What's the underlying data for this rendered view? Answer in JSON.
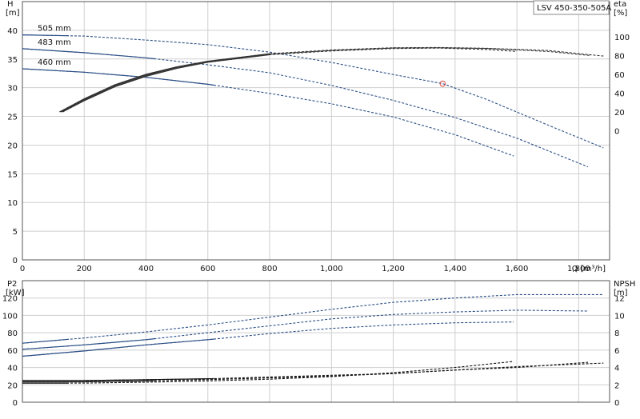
{
  "chart_data": [
    {
      "type": "line",
      "title": "LSV 450-350-505A",
      "x": {
        "label": "Q [m³/h]",
        "lim": [
          0,
          1900
        ],
        "ticks": [
          0,
          200,
          400,
          600,
          800,
          1000,
          1200,
          1400,
          1600,
          1800
        ],
        "tick_labels": [
          "0",
          "200",
          "400",
          "600",
          "800",
          "1,000",
          "1,200",
          "1,400",
          "1,600",
          "1,800"
        ]
      },
      "y_left": {
        "label_line1": "H",
        "label_line2": "[m]",
        "lim": [
          0,
          45
        ],
        "ticks": [
          0,
          5,
          10,
          15,
          20,
          25,
          30,
          35,
          40
        ]
      },
      "y_right": {
        "label_line1": "eta",
        "label_line2": "[%]",
        "lim": [
          -137.5,
          137.5
        ],
        "ticks": [
          0,
          20,
          40,
          60,
          80,
          100
        ]
      },
      "grid": true,
      "operating_point": {
        "x": 1360,
        "y": 30.7,
        "color": "#e0413a"
      },
      "series": [
        {
          "name": "505 mm",
          "axis": "left",
          "color": "#2b4f86",
          "solid_to": 150,
          "points": [
            [
              0,
              39.2
            ],
            [
              200,
              39.0
            ],
            [
              400,
              38.3
            ],
            [
              600,
              37.5
            ],
            [
              800,
              36.2
            ],
            [
              1000,
              34.4
            ],
            [
              1200,
              32.3
            ],
            [
              1360,
              30.7
            ],
            [
              1500,
              28.0
            ],
            [
              1700,
              23.5
            ],
            [
              1880,
              19.5
            ]
          ]
        },
        {
          "name": "483 mm",
          "axis": "left",
          "color": "#2b4f86",
          "solid_to": 430,
          "points": [
            [
              0,
              36.8
            ],
            [
              200,
              36.1
            ],
            [
              400,
              35.2
            ],
            [
              600,
              34.0
            ],
            [
              800,
              32.6
            ],
            [
              1000,
              30.4
            ],
            [
              1200,
              27.8
            ],
            [
              1400,
              24.8
            ],
            [
              1600,
              21.2
            ],
            [
              1830,
              16.2
            ]
          ]
        },
        {
          "name": "460 mm",
          "axis": "left",
          "color": "#2b4f86",
          "solid_to": 620,
          "points": [
            [
              0,
              33.3
            ],
            [
              200,
              32.7
            ],
            [
              400,
              31.8
            ],
            [
              600,
              30.6
            ],
            [
              800,
              29.0
            ],
            [
              1000,
              27.2
            ],
            [
              1200,
              24.9
            ],
            [
              1400,
              21.8
            ],
            [
              1590,
              18.1
            ]
          ]
        },
        {
          "axis": "right",
          "color": "#333333",
          "solid_to": 800,
          "points": [
            [
              120,
              20
            ],
            [
              200,
              34
            ],
            [
              300,
              49
            ],
            [
              400,
              60
            ],
            [
              500,
              68
            ],
            [
              600,
              74
            ],
            [
              800,
              82
            ],
            [
              1000,
              86
            ],
            [
              1200,
              88.4
            ],
            [
              1350,
              88.6
            ],
            [
              1500,
              87.8
            ],
            [
              1700,
              85.5
            ],
            [
              1880,
              79.5
            ]
          ]
        },
        {
          "axis": "right",
          "color": "#333333",
          "solid_to": 800,
          "points": [
            [
              125,
              20
            ],
            [
              200,
              33
            ],
            [
              300,
              48
            ],
            [
              400,
              59
            ],
            [
              500,
              67.5
            ],
            [
              600,
              73.5
            ],
            [
              800,
              81.5
            ],
            [
              1000,
              85.5
            ],
            [
              1200,
              88
            ],
            [
              1350,
              88.3
            ],
            [
              1500,
              87.6
            ],
            [
              1700,
              84.5
            ],
            [
              1840,
              80
            ]
          ]
        },
        {
          "axis": "right",
          "color": "#333333",
          "solid_to": 800,
          "points": [
            [
              130,
              20
            ],
            [
              200,
              32
            ],
            [
              300,
              47
            ],
            [
              400,
              58
            ],
            [
              500,
              66.5
            ],
            [
              600,
              73
            ],
            [
              800,
              81
            ],
            [
              1000,
              85
            ],
            [
              1200,
              87.5
            ],
            [
              1350,
              88
            ],
            [
              1500,
              86.5
            ],
            [
              1600,
              84.5
            ]
          ]
        }
      ]
    },
    {
      "type": "line",
      "x": {
        "lim": [
          0,
          1900
        ],
        "ticks": [
          0,
          200,
          400,
          600,
          800,
          1000,
          1200,
          1400,
          1600,
          1800
        ]
      },
      "y_left": {
        "label_line1": "P2",
        "label_line2": "[kW]",
        "lim": [
          0,
          140
        ],
        "ticks": [
          0,
          20,
          40,
          60,
          80,
          100,
          120
        ]
      },
      "y_right": {
        "label_line1": "NPSH",
        "label_line2": "[m]",
        "lim": [
          0,
          14
        ],
        "ticks": [
          0,
          2,
          4,
          6,
          8,
          10,
          12
        ]
      },
      "grid": true,
      "series": [
        {
          "axis": "left",
          "color": "#2b4f86",
          "solid_to": 150,
          "points": [
            [
              0,
              68
            ],
            [
              200,
              74
            ],
            [
              400,
              81
            ],
            [
              600,
              89
            ],
            [
              800,
              98
            ],
            [
              1000,
              107
            ],
            [
              1200,
              115
            ],
            [
              1400,
              120
            ],
            [
              1600,
              124
            ],
            [
              1880,
              124
            ]
          ]
        },
        {
          "axis": "left",
          "color": "#2b4f86",
          "solid_to": 430,
          "points": [
            [
              0,
              61
            ],
            [
              200,
              66
            ],
            [
              400,
              72
            ],
            [
              600,
              80
            ],
            [
              800,
              88
            ],
            [
              1000,
              96
            ],
            [
              1200,
              101
            ],
            [
              1400,
              104
            ],
            [
              1600,
              106
            ],
            [
              1830,
              105
            ]
          ]
        },
        {
          "axis": "left",
          "color": "#2b4f86",
          "solid_to": 620,
          "points": [
            [
              0,
              53
            ],
            [
              200,
              59
            ],
            [
              400,
              66
            ],
            [
              600,
              72
            ],
            [
              800,
              79
            ],
            [
              1000,
              85
            ],
            [
              1200,
              89
            ],
            [
              1400,
              91.5
            ],
            [
              1590,
              92.5
            ]
          ]
        },
        {
          "axis": "right",
          "color": "#111111",
          "solid_to": 620,
          "points": [
            [
              0,
              2.5
            ],
            [
              200,
              2.5
            ],
            [
              400,
              2.6
            ],
            [
              600,
              2.7
            ],
            [
              800,
              2.9
            ],
            [
              1000,
              3.1
            ],
            [
              1200,
              3.3
            ],
            [
              1400,
              3.7
            ],
            [
              1600,
              4.1
            ],
            [
              1880,
              4.5
            ]
          ]
        },
        {
          "axis": "right",
          "color": "#111111",
          "solid_to": 430,
          "points": [
            [
              0,
              2.35
            ],
            [
              200,
              2.35
            ],
            [
              400,
              2.45
            ],
            [
              600,
              2.6
            ],
            [
              800,
              2.8
            ],
            [
              1000,
              3.0
            ],
            [
              1200,
              3.3
            ],
            [
              1400,
              3.7
            ],
            [
              1600,
              4.0
            ],
            [
              1830,
              4.6
            ]
          ]
        },
        {
          "axis": "right",
          "color": "#111111",
          "solid_to": 150,
          "points": [
            [
              0,
              2.2
            ],
            [
              200,
              2.2
            ],
            [
              400,
              2.3
            ],
            [
              600,
              2.45
            ],
            [
              800,
              2.65
            ],
            [
              1000,
              2.95
            ],
            [
              1200,
              3.4
            ],
            [
              1400,
              4.0
            ],
            [
              1590,
              4.7
            ]
          ]
        }
      ]
    }
  ]
}
